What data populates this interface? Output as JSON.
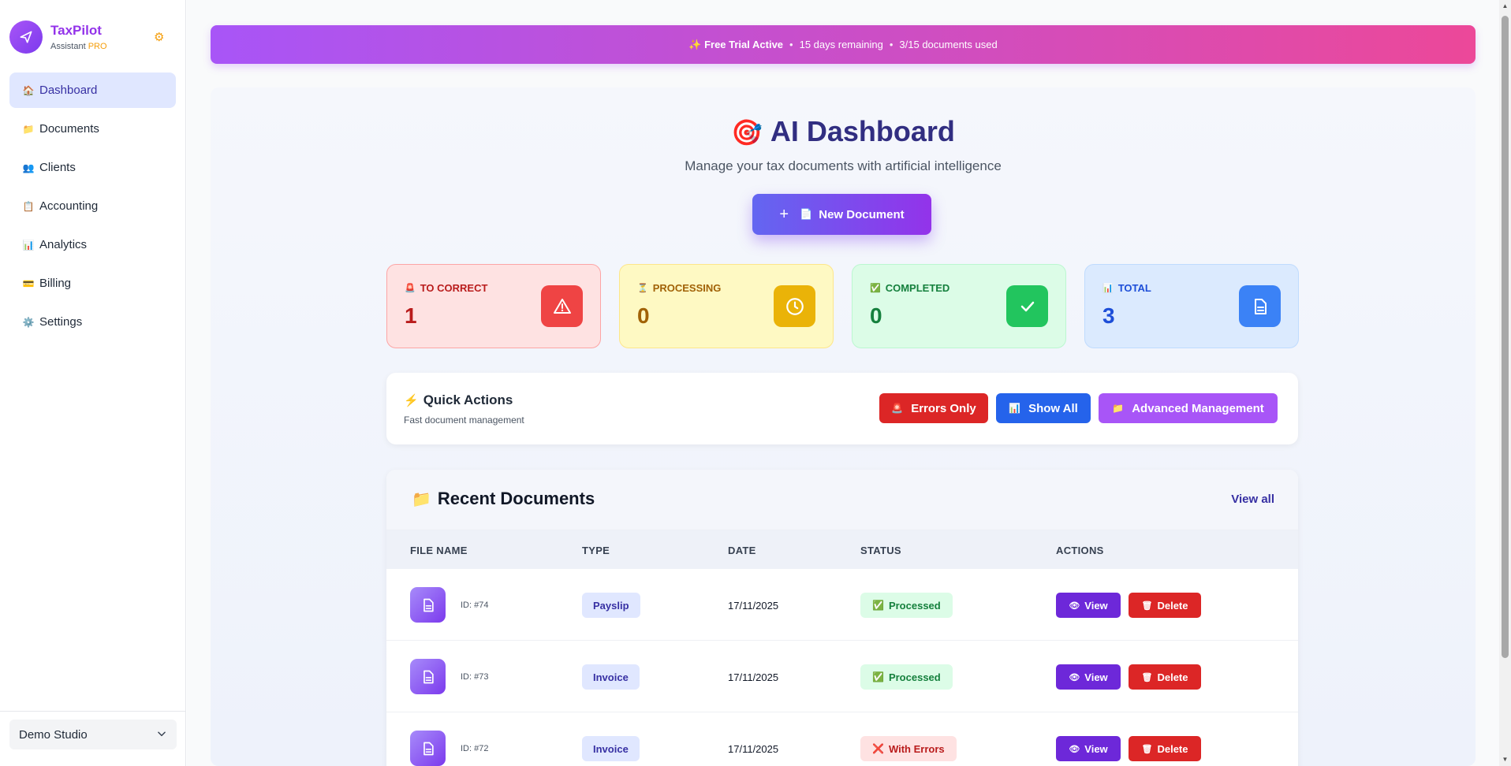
{
  "app": {
    "name": "TaxPilot",
    "subtitle": "Assistant",
    "tier": "PRO"
  },
  "sidebar": {
    "items": [
      {
        "label": "Dashboard",
        "icon": "🏠"
      },
      {
        "label": "Documents",
        "icon": "📁"
      },
      {
        "label": "Clients",
        "icon": "👥"
      },
      {
        "label": "Accounting",
        "icon": "📋"
      },
      {
        "label": "Analytics",
        "icon": "📊"
      },
      {
        "label": "Billing",
        "icon": "💳"
      },
      {
        "label": "Settings",
        "icon": "⚙️"
      }
    ],
    "studio_select": "Demo Studio"
  },
  "banner": {
    "title": "✨ Free Trial Active",
    "remaining": "15 days remaining",
    "usage": "3/15 documents used"
  },
  "hero": {
    "icon": "🎯",
    "title": "AI Dashboard",
    "subtitle": "Manage your tax documents with artificial intelligence",
    "new_button": "New Document",
    "new_button_plus": "+",
    "new_button_doc": "📄"
  },
  "stats": {
    "to_correct": {
      "label": "TO CORRECT",
      "icon": "🚨",
      "value": "1"
    },
    "processing": {
      "label": "PROCESSING",
      "icon": "⏳",
      "value": "0"
    },
    "completed": {
      "label": "COMPLETED",
      "icon": "✅",
      "value": "0"
    },
    "total": {
      "label": "TOTAL",
      "icon": "📊",
      "value": "3"
    }
  },
  "quick_actions": {
    "bolt": "⚡",
    "title": "Quick Actions",
    "subtitle": "Fast document management",
    "errors_only": "Errors Only",
    "errors_icon": "🚨",
    "show_all": "Show All",
    "show_all_icon": "📊",
    "advanced": "Advanced Management",
    "advanced_icon": "📁"
  },
  "recent": {
    "icon": "📁",
    "title": "Recent Documents",
    "view_all": "View all",
    "columns": [
      "FILE NAME",
      "TYPE",
      "DATE",
      "STATUS",
      "ACTIONS"
    ],
    "rows": [
      {
        "id": "ID: #74",
        "type": "Payslip",
        "date": "17/11/2025",
        "status": "Processed",
        "status_icon": "✅",
        "status_kind": "ok"
      },
      {
        "id": "ID: #73",
        "type": "Invoice",
        "date": "17/11/2025",
        "status": "Processed",
        "status_icon": "✅",
        "status_kind": "ok"
      },
      {
        "id": "ID: #72",
        "type": "Invoice",
        "date": "17/11/2025",
        "status": "With Errors",
        "status_icon": "❌",
        "status_kind": "err"
      }
    ],
    "view_label": "View",
    "view_icon": "👁",
    "delete_label": "Delete",
    "delete_icon": "🗑"
  },
  "colors": {
    "accent": "#7c3aed",
    "banner_from": "#a855f7",
    "banner_to": "#ec4899",
    "danger": "#dc2626",
    "info": "#2563eb",
    "success": "#22c55e",
    "warning": "#eab308"
  }
}
